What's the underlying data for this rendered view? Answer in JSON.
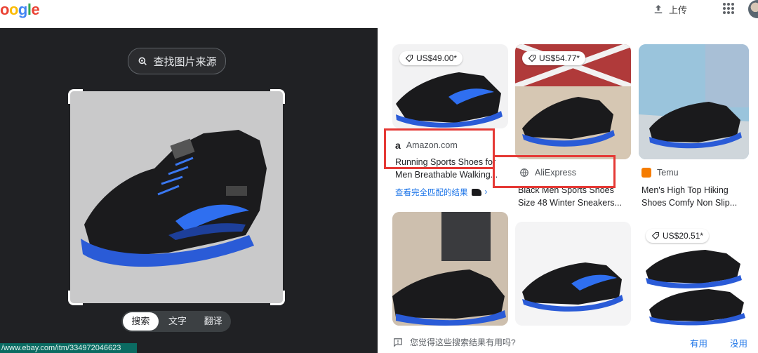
{
  "header": {
    "logo_text": "oogle",
    "upload_label": "上传"
  },
  "lens": {
    "find_source_label": "查找图片来源",
    "tabs": [
      "搜索",
      "文字",
      "翻译"
    ],
    "active_tab": "搜索",
    "status_url": "/www.ebay.com/itm/334972046623"
  },
  "results": [
    {
      "price": "US$49.00*",
      "source": "Amazon.com",
      "title": "Running Sports Shoes for Men Breathable Walking...",
      "exact_match_link": "查看完全匹配的结果"
    },
    {
      "price": "US$54.77*",
      "source": "AliExpress",
      "title": "Black Men Sports Shoes Size 48 Winter Sneakers..."
    },
    {
      "source": "Temu",
      "title": "Men's High Top Hiking Shoes Comfy Non Slip..."
    },
    {},
    {},
    {
      "price": "US$20.51*"
    }
  ],
  "feedback": {
    "question": "您觉得这些搜索结果有用吗?",
    "yes": "有用",
    "no": "没用"
  },
  "colors": {
    "accent": "#1a73e8",
    "highlight": "#e53935",
    "dark_panel": "#202124"
  }
}
